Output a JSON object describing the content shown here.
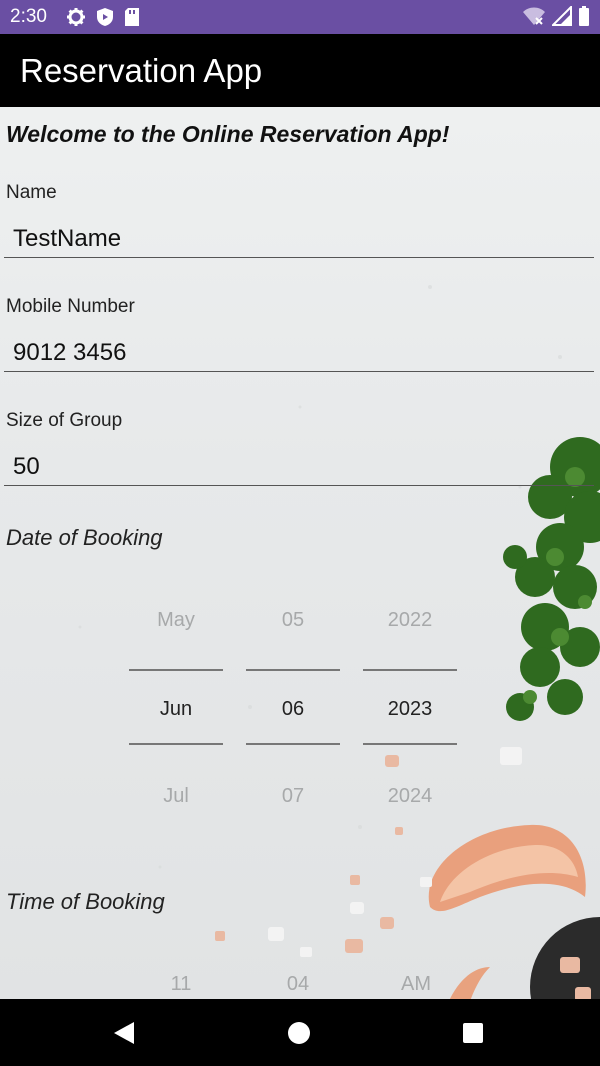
{
  "status": {
    "time": "2:30"
  },
  "app": {
    "title": "Reservation App"
  },
  "form": {
    "welcome": "Welcome to the Online Reservation App!",
    "name": {
      "label": "Name",
      "value": "TestName"
    },
    "mobile": {
      "label": "Mobile Number",
      "value": "9012 3456"
    },
    "group": {
      "label": "Size of Group",
      "value": "50"
    },
    "date_label": "Date of Booking",
    "time_label": "Time of Booking"
  },
  "date_picker": {
    "month": {
      "prev": "May",
      "selected": "Jun",
      "next": "Jul"
    },
    "day": {
      "prev": "05",
      "selected": "06",
      "next": "07"
    },
    "year": {
      "prev": "2022",
      "selected": "2023",
      "next": "2024"
    }
  },
  "time_picker": {
    "hour": {
      "next": "11"
    },
    "minute": {
      "next": "04"
    },
    "ampm": {
      "next": "AM"
    }
  },
  "colors": {
    "status_bar": "#6a4fa3",
    "app_bar": "#000000",
    "nav_bar": "#000000"
  }
}
